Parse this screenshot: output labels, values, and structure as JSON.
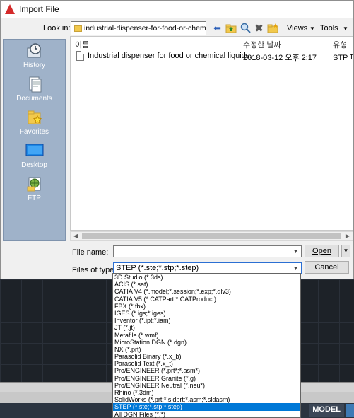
{
  "dialog": {
    "title": "Import File"
  },
  "toolbar": {
    "look_in_label": "Look in:",
    "look_in_value": "industrial-dispenser-for-food-or-chemical-liquids",
    "views_label": "Views",
    "tools_label": "Tools"
  },
  "places": [
    {
      "label": "History",
      "icon": "history-icon"
    },
    {
      "label": "Documents",
      "icon": "documents-icon"
    },
    {
      "label": "Favorites",
      "icon": "favorites-icon"
    },
    {
      "label": "Desktop",
      "icon": "desktop-icon"
    },
    {
      "label": "FTP",
      "icon": "ftp-icon"
    }
  ],
  "file_list": {
    "columns": [
      "이름",
      "수정한 날짜",
      "유형"
    ],
    "files": [
      {
        "name": "Industrial dispenser for food or chemical liquids.",
        "modified": "2018-03-12 오후 2:17",
        "type": "STP 파"
      }
    ]
  },
  "form": {
    "file_name_label": "File name:",
    "file_name_value": "",
    "file_type_label": "Files of type:",
    "file_type_value": "STEP (*.ste;*.stp;*.step)",
    "open_label": "Open",
    "cancel_label": "Cancel"
  },
  "file_type_options": [
    "3D Studio (*.3ds)",
    "ACIS (*.sat)",
    "CATIA V4 (*.model;*.session;*.exp;*.dlv3)",
    "CATIA V5 (*.CATPart;*.CATProduct)",
    "FBX (*.fbx)",
    "IGES (*.igs;*.iges)",
    "Inventor (*.ipt;*.iam)",
    "JT (*.jt)",
    "Metafile (*.wmf)",
    "MicroStation DGN (*.dgn)",
    "NX (*.prt)",
    "Parasolid Binary (*.x_b)",
    "Parasolid Text (*.x_t)",
    "Pro/ENGINEER (*.prt*;*.asm*)",
    "Pro/ENGINEER Granite (*.g)",
    "Pro/ENGINEER Neutral (*.neu*)",
    "Rhino (*.3dm)",
    "SolidWorks (*.prt;*.sldprt;*.asm;*.sldasm)",
    "STEP (*.ste;*.stp;*.step)",
    "All DGN Files (*.*)"
  ],
  "selected_option_index": 18,
  "statusbar": {
    "model_label": "MODEL"
  },
  "colors": {
    "selection": "#0078d7",
    "places_bg": "#9fb2c9",
    "cad_bg": "#212830"
  }
}
